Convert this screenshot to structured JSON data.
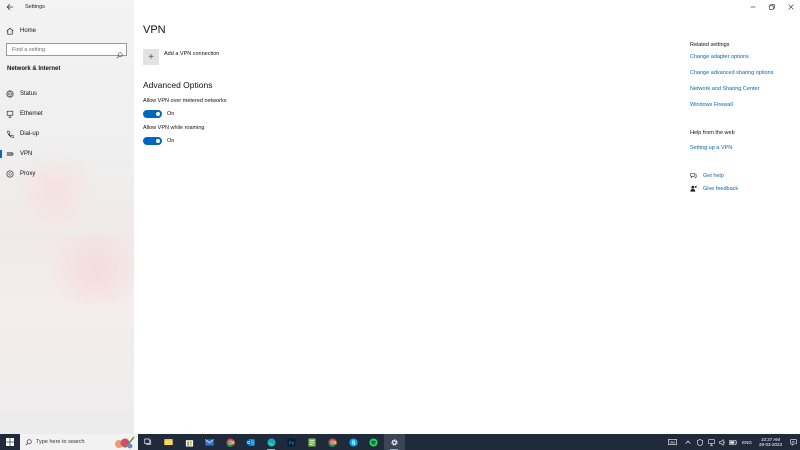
{
  "window": {
    "app_title": "Settings"
  },
  "sidebar": {
    "home_label": "Home",
    "search_placeholder": "Find a setting",
    "section_label": "Network & Internet",
    "items": [
      {
        "label": "Status",
        "icon": "globe-icon"
      },
      {
        "label": "Ethernet",
        "icon": "ethernet-icon"
      },
      {
        "label": "Dial-up",
        "icon": "phone-icon"
      },
      {
        "label": "VPN",
        "icon": "vpn-icon",
        "selected": true
      },
      {
        "label": "Proxy",
        "icon": "proxy-globe-icon"
      }
    ]
  },
  "main": {
    "title": "VPN",
    "add_vpn_label": "Add a VPN connection",
    "advanced_title": "Advanced Options",
    "options": [
      {
        "label": "Allow VPN over metered networks",
        "state": "On"
      },
      {
        "label": "Allow VPN while roaming",
        "state": "On"
      }
    ]
  },
  "related": {
    "heading": "Related settings",
    "links": [
      "Change adapter options",
      "Change advanced sharing options",
      "Network and Sharing Center",
      "Windows Firewall"
    ]
  },
  "help": {
    "heading": "Help from the web",
    "link": "Setting up a VPN",
    "get_help": "Get help",
    "give_feedback": "Give feedback"
  },
  "taskbar": {
    "search_placeholder": "Type here to search",
    "apps": [
      "task-view-icon",
      "file-explorer-icon",
      "store-icon",
      "mail-icon",
      "chrome-icon",
      "outlook-icon",
      "edge-icon",
      "photoshop-icon",
      "notepad-icon",
      "chrome-icon",
      "skype-icon",
      "spotify-icon",
      "settings-icon"
    ],
    "language": "ENG",
    "time": "10:37 AM",
    "date": "28-03-2023"
  },
  "colors": {
    "accent": "#0067c0",
    "taskbar": "#1f2b3a"
  }
}
